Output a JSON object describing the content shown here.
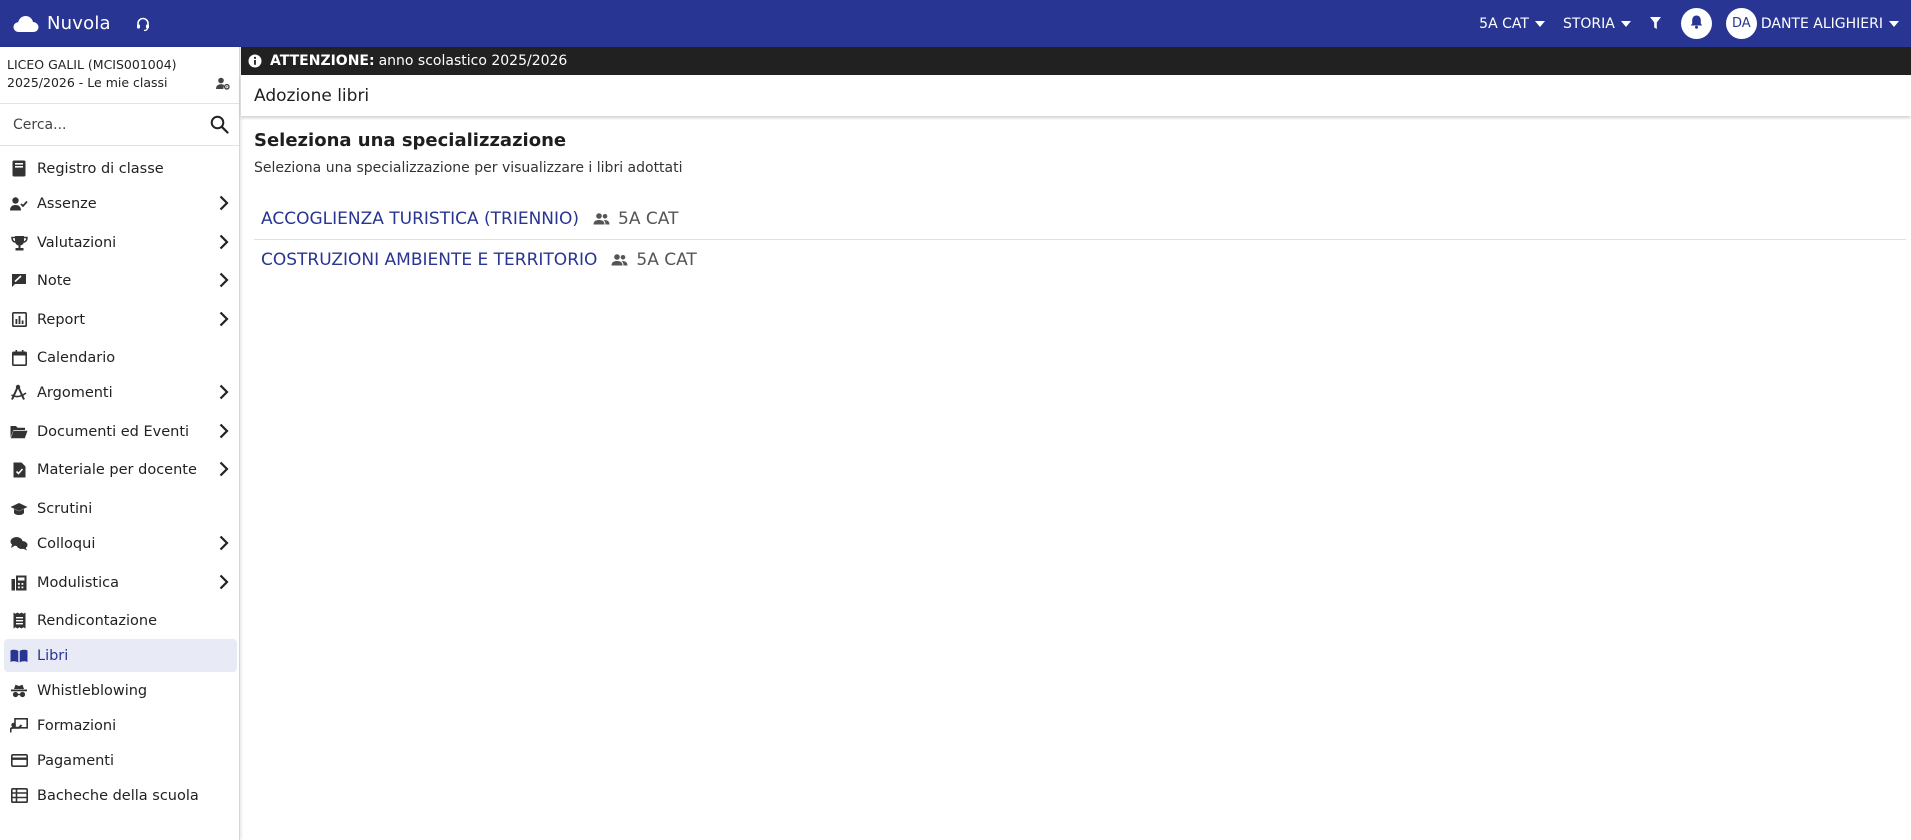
{
  "app": {
    "name": "Nuvola"
  },
  "topbar": {
    "class_selector": "5A CAT",
    "subject_selector": "STORIA",
    "avatar_initials": "DA",
    "user_name": "DANTE ALIGHIERI"
  },
  "sidebar": {
    "school_line": "LICEO GALIL (MCIS001004)",
    "year_line": "2025/2026 - Le mie classi",
    "search_placeholder": "Cerca...",
    "items": [
      {
        "label": "Registro di classe",
        "icon": "book-icon",
        "has_submenu": false
      },
      {
        "label": "Assenze",
        "icon": "user-check-icon",
        "has_submenu": true
      },
      {
        "label": "Valutazioni",
        "icon": "trophy-icon",
        "has_submenu": true
      },
      {
        "label": "Note",
        "icon": "note-icon",
        "has_submenu": true
      },
      {
        "label": "Report",
        "icon": "bar-chart-icon",
        "has_submenu": true
      },
      {
        "label": "Calendario",
        "icon": "calendar-icon",
        "has_submenu": false
      },
      {
        "label": "Argomenti",
        "icon": "compass-icon",
        "has_submenu": true
      },
      {
        "label": "Documenti ed Eventi",
        "icon": "folder-open-icon",
        "has_submenu": true
      },
      {
        "label": "Materiale per docente",
        "icon": "file-check-icon",
        "has_submenu": true
      },
      {
        "label": "Scrutini",
        "icon": "graduation-cap-icon",
        "has_submenu": false
      },
      {
        "label": "Colloqui",
        "icon": "chat-icon",
        "has_submenu": true
      },
      {
        "label": "Modulistica",
        "icon": "fax-icon",
        "has_submenu": true
      },
      {
        "label": "Rendicontazione",
        "icon": "receipt-icon",
        "has_submenu": false
      },
      {
        "label": "Libri",
        "icon": "open-book-icon",
        "has_submenu": false,
        "active": true
      },
      {
        "label": "Whistleblowing",
        "icon": "incognito-icon",
        "has_submenu": false
      },
      {
        "label": "Formazioni",
        "icon": "presentation-icon",
        "has_submenu": false
      },
      {
        "label": "Pagamenti",
        "icon": "credit-card-icon",
        "has_submenu": false
      },
      {
        "label": "Bacheche della scuola",
        "icon": "table-icon",
        "has_submenu": false
      }
    ]
  },
  "alert": {
    "label": "ATTENZIONE:",
    "text": "anno scolastico 2025/2026"
  },
  "page": {
    "title": "Adozione libri",
    "heading": "Seleziona una specializzazione",
    "subheading": "Seleziona una specializzazione per visualizzare i libri adottati",
    "specializations": [
      {
        "name": "ACCOGLIENZA TURISTICA (TRIENNIO)",
        "class": "5A CAT"
      },
      {
        "name": "COSTRUZIONI AMBIENTE E TERRITORIO",
        "class": "5A CAT"
      }
    ]
  },
  "colors": {
    "primary": "#283593",
    "alert_bg": "#212121",
    "active_bg": "#e8eaf6"
  }
}
